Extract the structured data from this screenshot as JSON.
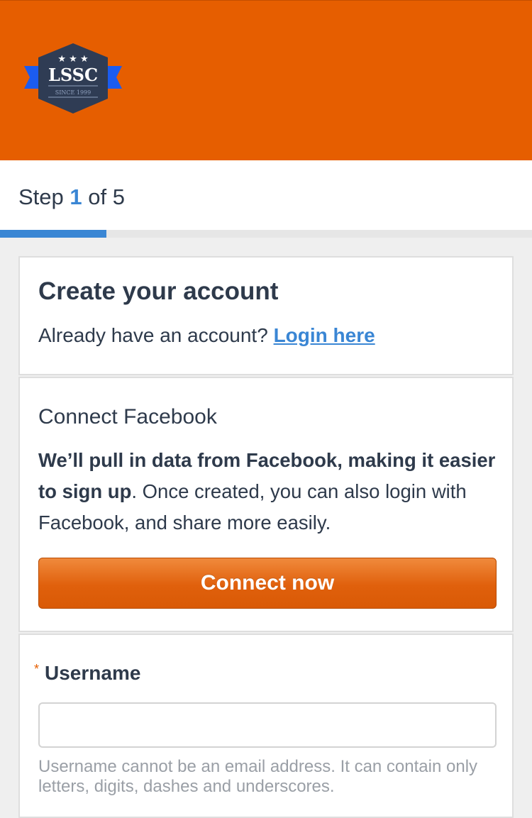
{
  "header": {
    "logo": {
      "text": "LSSC",
      "tagline": "SINCE 1999",
      "colors": {
        "badge": "#2f3c54",
        "ribbon": "#1b5cf0"
      }
    },
    "background_color": "#e65e00"
  },
  "progress": {
    "step_prefix": "Step",
    "current_step": "1",
    "step_suffix": "of 5",
    "fraction_complete": 0.2,
    "color": "#3a86d4"
  },
  "account": {
    "title": "Create your account",
    "already_text": "Already have an account?",
    "login_link": "Login here"
  },
  "facebook": {
    "heading": "Connect Facebook",
    "desc_bold": "We’ll pull in data from Facebook, making it easier to sign up",
    "desc_rest": ". Once created, you can also login with Facebook, and share more easily.",
    "button_label": "Connect now"
  },
  "username": {
    "required_mark": "*",
    "label": "Username",
    "value": "",
    "placeholder": "",
    "hint": "Username cannot be an email address. It can contain only letters, digits, dashes and underscores."
  }
}
